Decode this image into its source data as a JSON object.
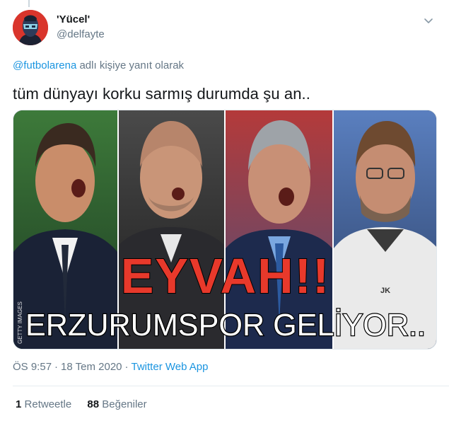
{
  "tweet": {
    "display_name": "'Yücel'",
    "handle": "@delfayte",
    "reply_mention": "@futbolarena",
    "reply_suffix": " adlı kişiye yanıt olarak",
    "text": "tüm dünyayı korku sarmış durumda şu an..",
    "time": "ÖS 9:57",
    "date": "18 Tem 2020",
    "source": "Twitter Web App",
    "retweets_count": "1",
    "retweets_label": "Retweetle",
    "likes_count": "88",
    "likes_label": "Beğeniler"
  },
  "media": {
    "headline": "EYVAH!!",
    "subline": "ERZURUMSPOR GELİYOR..",
    "credit": "GETTY IMAGES",
    "kit_badge": "JK",
    "colors": {
      "headline_red": "#e8392b",
      "subline_white": "#ffffff"
    }
  },
  "icons": {
    "more": "chevron-down-icon",
    "avatar": "masked-face-avatar"
  }
}
